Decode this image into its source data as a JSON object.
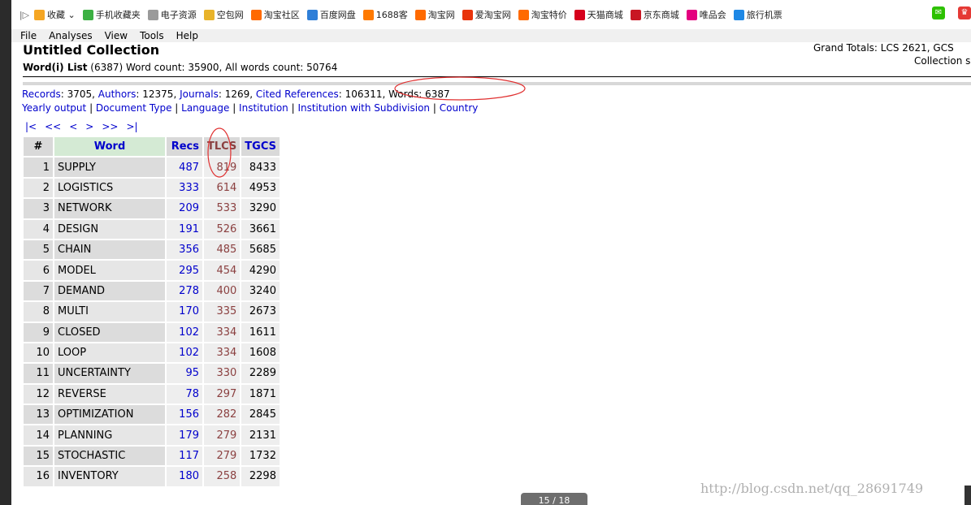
{
  "bookmarks": {
    "expand_glyph": "|▷",
    "items": [
      {
        "label": "收藏 ⌄",
        "color": "#f5a623"
      },
      {
        "label": "手机收藏夹",
        "color": "#3cb043"
      },
      {
        "label": "电子资源",
        "color": "#9a9a9a"
      },
      {
        "label": "空包网",
        "color": "#e8b32a"
      },
      {
        "label": "淘宝社区",
        "color": "#ff6a00"
      },
      {
        "label": "百度网盘",
        "color": "#2f7fd8"
      },
      {
        "label": "1688客",
        "color": "#ff7a00"
      },
      {
        "label": "淘宝网",
        "color": "#ff6a00"
      },
      {
        "label": "爱淘宝网",
        "color": "#e8340c"
      },
      {
        "label": "淘宝特价",
        "color": "#ff6a00"
      },
      {
        "label": "天猫商城",
        "color": "#d6001c"
      },
      {
        "label": "京东商城",
        "color": "#c81623"
      },
      {
        "label": "唯品会",
        "color": "#e4007f"
      },
      {
        "label": "旅行机票",
        "color": "#1e88e5"
      }
    ]
  },
  "menu": [
    "File",
    "Analyses",
    "View",
    "Tools",
    "Help"
  ],
  "collection": {
    "title": "Untitled Collection",
    "list_title": "Word(i) List",
    "list_stats": "(6387) Word count: 35900, All words count: 50764",
    "grand_totals": "Grand Totals: LCS 2621, GCS",
    "collection_cut": "Collection s"
  },
  "stats": [
    {
      "label": "Records",
      "value": ": 3705, "
    },
    {
      "label": "Authors",
      "value": ": 12375, "
    },
    {
      "label": "Journals",
      "value": ": 1269, "
    },
    {
      "label": "Cited References",
      "value": ": 106311, "
    },
    {
      "label": "Words",
      "value": ": 6387"
    }
  ],
  "analyses": [
    "Yearly output",
    "Document Type",
    "Language",
    "Institution",
    "Institution with Subdivision",
    "Country"
  ],
  "pager": [
    "|<",
    "<<",
    "<",
    ">",
    ">>",
    ">|"
  ],
  "table": {
    "headers": {
      "num": "#",
      "word": "Word",
      "recs": "Recs",
      "tlcs": "TLCS",
      "tgcs": "TGCS"
    },
    "rows": [
      {
        "n": "1",
        "word": "SUPPLY",
        "recs": "487",
        "tlcs": "819",
        "tgcs": "8433"
      },
      {
        "n": "2",
        "word": "LOGISTICS",
        "recs": "333",
        "tlcs": "614",
        "tgcs": "4953"
      },
      {
        "n": "3",
        "word": "NETWORK",
        "recs": "209",
        "tlcs": "533",
        "tgcs": "3290"
      },
      {
        "n": "4",
        "word": "DESIGN",
        "recs": "191",
        "tlcs": "526",
        "tgcs": "3661"
      },
      {
        "n": "5",
        "word": "CHAIN",
        "recs": "356",
        "tlcs": "485",
        "tgcs": "5685"
      },
      {
        "n": "6",
        "word": "MODEL",
        "recs": "295",
        "tlcs": "454",
        "tgcs": "4290"
      },
      {
        "n": "7",
        "word": "DEMAND",
        "recs": "278",
        "tlcs": "400",
        "tgcs": "3240"
      },
      {
        "n": "8",
        "word": "MULTI",
        "recs": "170",
        "tlcs": "335",
        "tgcs": "2673"
      },
      {
        "n": "9",
        "word": "CLOSED",
        "recs": "102",
        "tlcs": "334",
        "tgcs": "1611"
      },
      {
        "n": "10",
        "word": "LOOP",
        "recs": "102",
        "tlcs": "334",
        "tgcs": "1608"
      },
      {
        "n": "11",
        "word": "UNCERTAINTY",
        "recs": "95",
        "tlcs": "330",
        "tgcs": "2289"
      },
      {
        "n": "12",
        "word": "REVERSE",
        "recs": "78",
        "tlcs": "297",
        "tgcs": "1871"
      },
      {
        "n": "13",
        "word": "OPTIMIZATION",
        "recs": "156",
        "tlcs": "282",
        "tgcs": "2845"
      },
      {
        "n": "14",
        "word": "PLANNING",
        "recs": "179",
        "tlcs": "279",
        "tgcs": "2131"
      },
      {
        "n": "15",
        "word": "STOCHASTIC",
        "recs": "117",
        "tlcs": "279",
        "tgcs": "1732"
      },
      {
        "n": "16",
        "word": "INVENTORY",
        "recs": "180",
        "tlcs": "258",
        "tgcs": "2298"
      }
    ]
  },
  "page_indicator": "15 / 18",
  "watermark": "http://blog.csdn.net/qq_28691749",
  "colors": {
    "link": "#0000cc",
    "tlcs": "#8b4040",
    "annotation": "#e03030",
    "word_header": "#d4ead4"
  }
}
